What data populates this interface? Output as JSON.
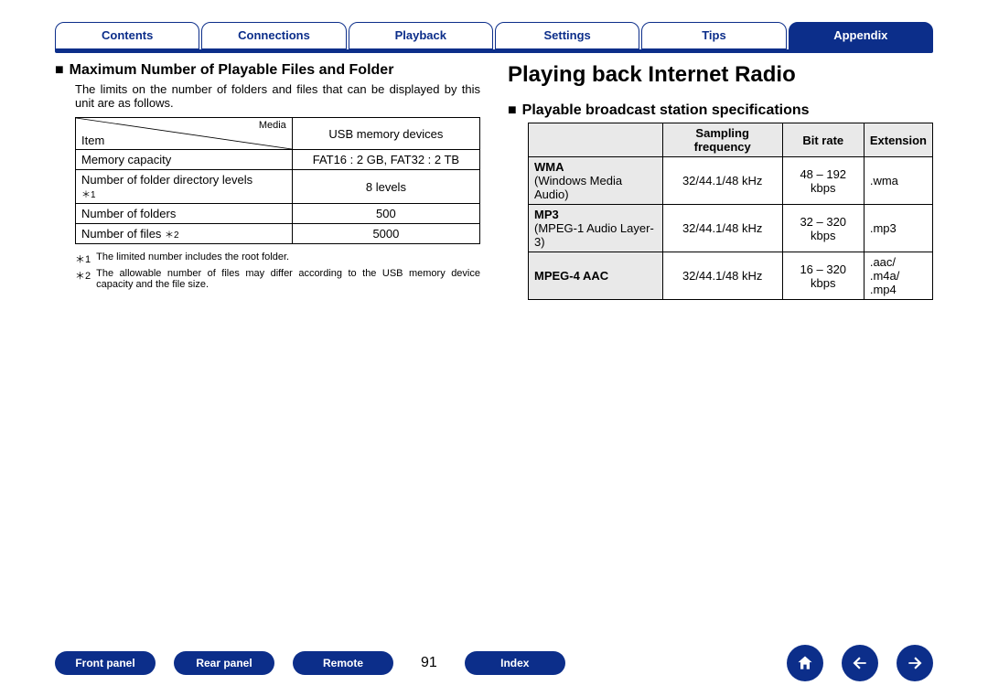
{
  "tabs": {
    "contents": "Contents",
    "connections": "Connections",
    "playback": "Playback",
    "settings": "Settings",
    "tips": "Tips",
    "appendix": "Appendix"
  },
  "left": {
    "section_title": "Maximum Number of Playable Files and Folder",
    "description": "The limits on the number of folders and files that can be displayed by this unit are as follows.",
    "table": {
      "media_label": "Media",
      "item_label": "Item",
      "col_header": "USB memory devices",
      "rows": [
        {
          "label": "Memory capacity",
          "value": "FAT16 : 2 GB, FAT32 : 2 TB"
        },
        {
          "label": "Number of folder directory levels",
          "sup": "＊1",
          "value": "8 levels"
        },
        {
          "label": "Number of folders",
          "value": "500"
        },
        {
          "label": "Number of files",
          "sup": "＊2",
          "value": "5000"
        }
      ]
    },
    "notes": [
      {
        "marker": "＊1",
        "text": "The limited number includes the root folder."
      },
      {
        "marker": "＊2",
        "text": "The allowable number of files may differ according to the USB memory device capacity and the file size."
      }
    ]
  },
  "right": {
    "page_title": "Playing back Internet Radio",
    "section_title": "Playable broadcast station specifications",
    "table": {
      "headers": {
        "sampling": "Sampling frequency",
        "bitrate": "Bit rate",
        "extension": "Extension"
      },
      "rows": [
        {
          "name": "WMA",
          "sub": "(Windows Media Audio)",
          "sampling": "32/44.1/48 kHz",
          "bitrate": "48 – 192 kbps",
          "ext": ".wma"
        },
        {
          "name": "MP3",
          "sub": "(MPEG-1 Audio Layer-3)",
          "sampling": "32/44.1/48 kHz",
          "bitrate": "32 – 320 kbps",
          "ext": ".mp3"
        },
        {
          "name": "MPEG-4 AAC",
          "sub": "",
          "sampling": "32/44.1/48 kHz",
          "bitrate": "16 – 320 kbps",
          "ext": ".aac/\n.m4a/\n.mp4"
        }
      ]
    }
  },
  "bottom": {
    "front_panel": "Front panel",
    "rear_panel": "Rear panel",
    "remote": "Remote",
    "index": "Index",
    "page_number": "91"
  }
}
